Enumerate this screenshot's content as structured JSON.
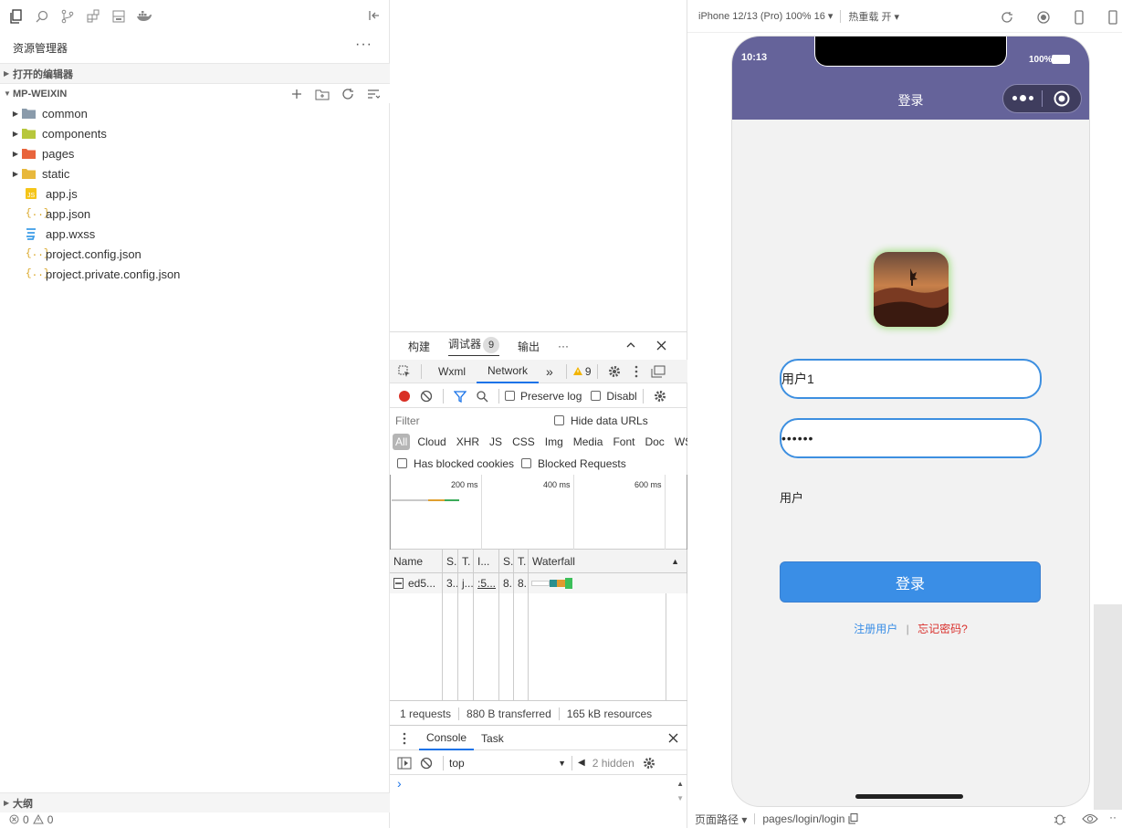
{
  "explorer": {
    "title": "资源管理器",
    "more": "···",
    "open_editors": "打开的编辑器",
    "project": "MP-WEIXIN",
    "tree": [
      {
        "name": "common",
        "kind": "folder",
        "color": "#8a9bab"
      },
      {
        "name": "components",
        "kind": "folder",
        "color": "#b7c73c"
      },
      {
        "name": "pages",
        "kind": "folder",
        "color": "#e8643c"
      },
      {
        "name": "static",
        "kind": "folder",
        "color": "#e8b83c"
      },
      {
        "name": "app.js",
        "kind": "js"
      },
      {
        "name": "app.json",
        "kind": "json"
      },
      {
        "name": "app.wxss",
        "kind": "wxss"
      },
      {
        "name": "project.config.json",
        "kind": "json"
      },
      {
        "name": "project.private.config.json",
        "kind": "json"
      }
    ],
    "outline": "大纲",
    "status_errors": "0",
    "status_warnings": "0"
  },
  "debugger": {
    "tabs": [
      "构建",
      "调试器",
      "输出"
    ],
    "active_tab": "调试器",
    "badge": "9",
    "more": "···",
    "panel_tabs": [
      "Wxml",
      "Network"
    ],
    "panel_more": "»",
    "warn_count": "9",
    "preserve_log": "Preserve log",
    "disable_cache": "Disabl",
    "filter_placeholder": "Filter",
    "hide_data_urls": "Hide data URLs",
    "types": [
      "All",
      "Cloud",
      "XHR",
      "JS",
      "CSS",
      "Img",
      "Media",
      "Font",
      "Doc",
      "WS"
    ],
    "has_blocked_cookies": "Has blocked cookies",
    "blocked_requests": "Blocked Requests",
    "timeline_labels": [
      "200 ms",
      "400 ms",
      "600 ms"
    ],
    "columns": [
      "Name",
      "S.",
      "T.",
      "I...",
      "S.",
      "T.",
      "Waterfall"
    ],
    "rows": [
      {
        "name": "ed5...",
        "status": "3..",
        "type": "j...",
        "initiator": ":5...",
        "size": "8..",
        "time": "8.."
      }
    ],
    "summary": [
      "1 requests",
      "880 B transferred",
      "165 kB resources"
    ],
    "console_tabs": [
      "Console",
      "Task"
    ],
    "context": "top",
    "hidden": "2 hidden",
    "prompt": "›"
  },
  "simulator": {
    "device": "iPhone 12/13 (Pro) 100% 16",
    "hot_reload": "热重载 开",
    "time": "10:13",
    "battery": "100%",
    "nav_title": "登录",
    "username": "用户1",
    "password": "••••••",
    "user_type": "用户",
    "login_button": "登录",
    "register_link": "注册用户",
    "divider": "|",
    "forgot_link": "忘记密码?",
    "page_path_label": "页面路径",
    "page_path": "pages/login/login",
    "colors": {
      "nav": "#65639a",
      "button": "#3a8ee6",
      "register": "#3a8ee6",
      "forgot": "#d9302c"
    }
  }
}
